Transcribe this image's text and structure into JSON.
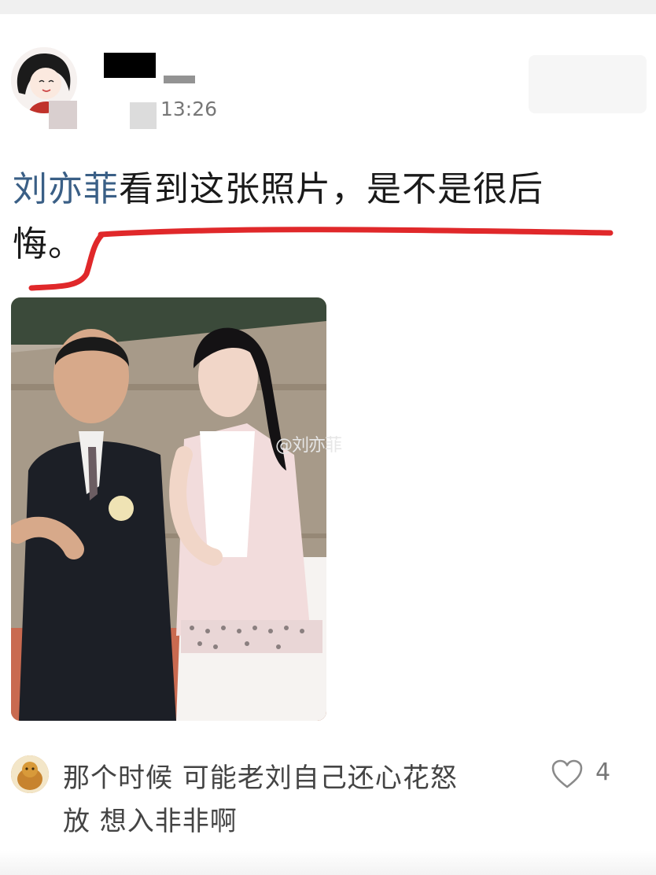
{
  "post": {
    "time": "13:26",
    "mention": "刘亦菲",
    "text_line1_rest": "看到这张照片，是不是很后",
    "text_line2": "悔。",
    "image_watermark": "@刘亦菲",
    "annotation_color": "#e0282a"
  },
  "comment": {
    "text_line1": "那个时候 可能老刘自己还心花怒",
    "text_line2": "放 想入非非啊",
    "like_count": "4",
    "like_icon": "heart-outline-icon"
  }
}
